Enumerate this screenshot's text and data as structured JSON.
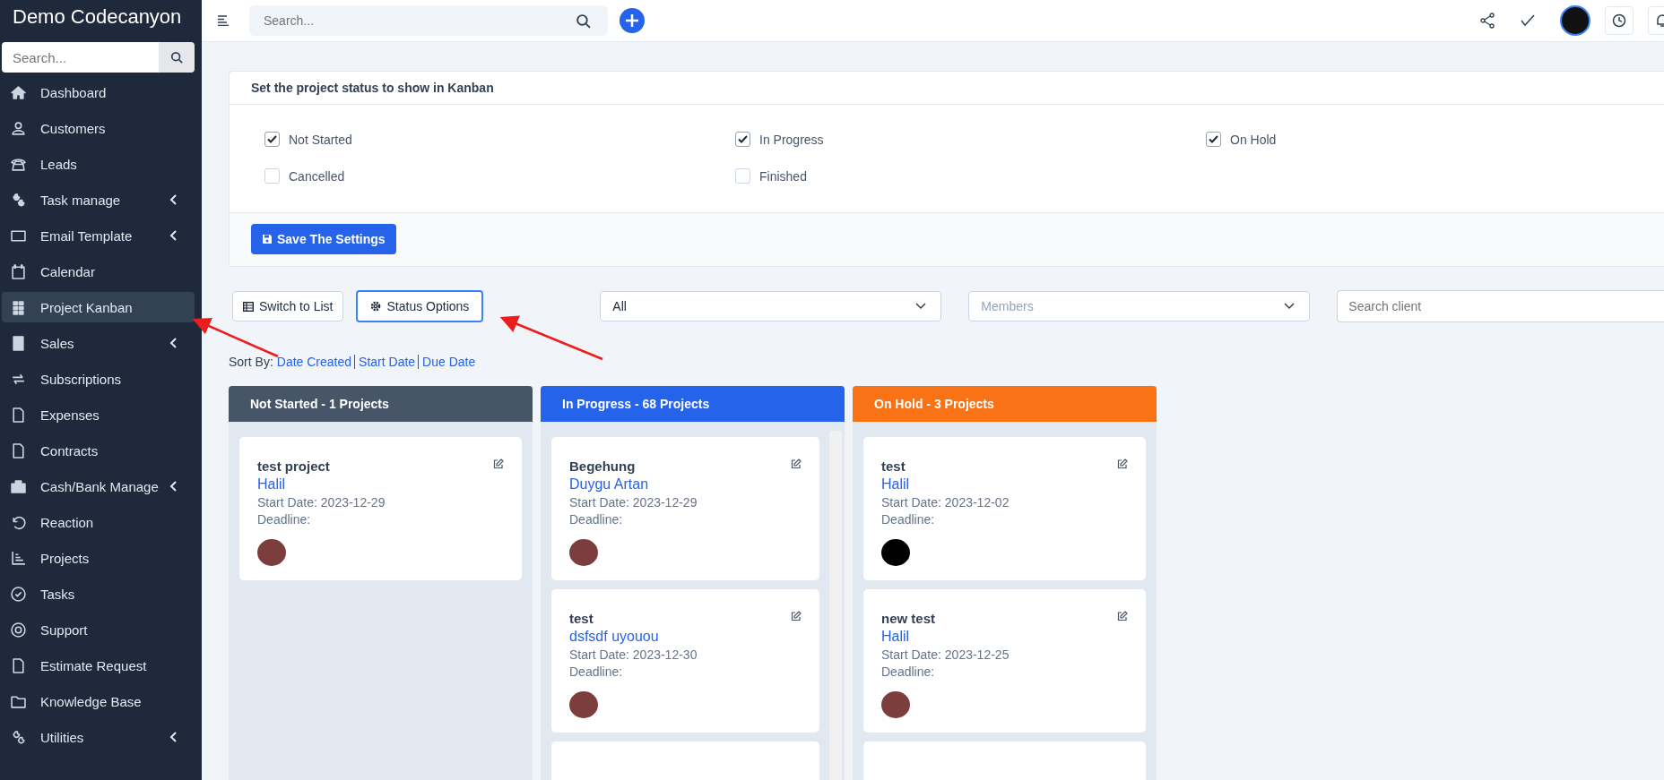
{
  "brand": "Demo Codecanyon",
  "sidebar": {
    "search": {
      "placeholder": "Search..."
    },
    "items": [
      {
        "label": "Dashboard",
        "selected": false,
        "has_submenu": false
      },
      {
        "label": "Customers",
        "selected": false,
        "has_submenu": false
      },
      {
        "label": "Leads",
        "selected": false,
        "has_submenu": false
      },
      {
        "label": "Task manage",
        "selected": false,
        "has_submenu": true
      },
      {
        "label": "Email Template",
        "selected": false,
        "has_submenu": true
      },
      {
        "label": "Calendar",
        "selected": false,
        "has_submenu": false
      },
      {
        "label": "Project Kanban",
        "selected": true,
        "has_submenu": false
      },
      {
        "label": "Sales",
        "selected": false,
        "has_submenu": true
      },
      {
        "label": "Subscriptions",
        "selected": false,
        "has_submenu": false
      },
      {
        "label": "Expenses",
        "selected": false,
        "has_submenu": false
      },
      {
        "label": "Contracts",
        "selected": false,
        "has_submenu": false
      },
      {
        "label": "Cash/Bank Manage",
        "selected": false,
        "has_submenu": true
      },
      {
        "label": "Reaction",
        "selected": false,
        "has_submenu": false
      },
      {
        "label": "Projects",
        "selected": false,
        "has_submenu": false
      },
      {
        "label": "Tasks",
        "selected": false,
        "has_submenu": false
      },
      {
        "label": "Support",
        "selected": false,
        "has_submenu": false
      },
      {
        "label": "Estimate Request",
        "selected": false,
        "has_submenu": false
      },
      {
        "label": "Knowledge Base",
        "selected": false,
        "has_submenu": false
      },
      {
        "label": "Utilities",
        "selected": false,
        "has_submenu": true
      }
    ]
  },
  "topbar": {
    "search": {
      "placeholder": "Search..."
    }
  },
  "settings": {
    "title": "Set the project status to show in Kanban",
    "statuses": [
      {
        "label": "Not Started",
        "checked": true
      },
      {
        "label": "In Progress",
        "checked": true
      },
      {
        "label": "On Hold",
        "checked": true
      },
      {
        "label": "Cancelled",
        "checked": false
      },
      {
        "label": "Finished",
        "checked": false
      }
    ],
    "save_button": "Save The Settings"
  },
  "toolbar": {
    "switch_button": "Switch to List",
    "status_button": "Status Options",
    "status_filter": {
      "value": "All"
    },
    "members_filter": {
      "placeholder": "Members"
    },
    "client_search": {
      "placeholder": "Search client"
    }
  },
  "sort": {
    "label": "Sort By:",
    "options": [
      "Date Created",
      "Start Date",
      "Due Date"
    ]
  },
  "columns": [
    {
      "title": "Not Started - 1 Projects",
      "color": "#475569",
      "cut_card": false,
      "cards": [
        {
          "name": "test project",
          "client": "Halil",
          "start_date": "Start Date: 2023-12-29",
          "deadline": "Deadline:",
          "avatar_dark": false
        }
      ]
    },
    {
      "title": "In Progress - 68 Projects",
      "color": "#2563eb",
      "cut_card": true,
      "cards": [
        {
          "name": "Begehung",
          "client": "Duygu Artan",
          "start_date": "Start Date: 2023-12-29",
          "deadline": "Deadline:",
          "avatar_dark": false
        },
        {
          "name": "test",
          "client": "dsfsdf uyouou",
          "start_date": "Start Date: 2023-12-30",
          "deadline": "Deadline:",
          "avatar_dark": false
        }
      ]
    },
    {
      "title": "On Hold - 3 Projects",
      "color": "#f97316",
      "cut_card": true,
      "cards": [
        {
          "name": "test",
          "client": "Halil",
          "start_date": "Start Date: 2023-12-02",
          "deadline": "Deadline:",
          "avatar_dark": true
        },
        {
          "name": "new test",
          "client": "Halil",
          "start_date": "Start Date: 2023-12-25",
          "deadline": "Deadline:",
          "avatar_dark": false
        }
      ]
    }
  ]
}
